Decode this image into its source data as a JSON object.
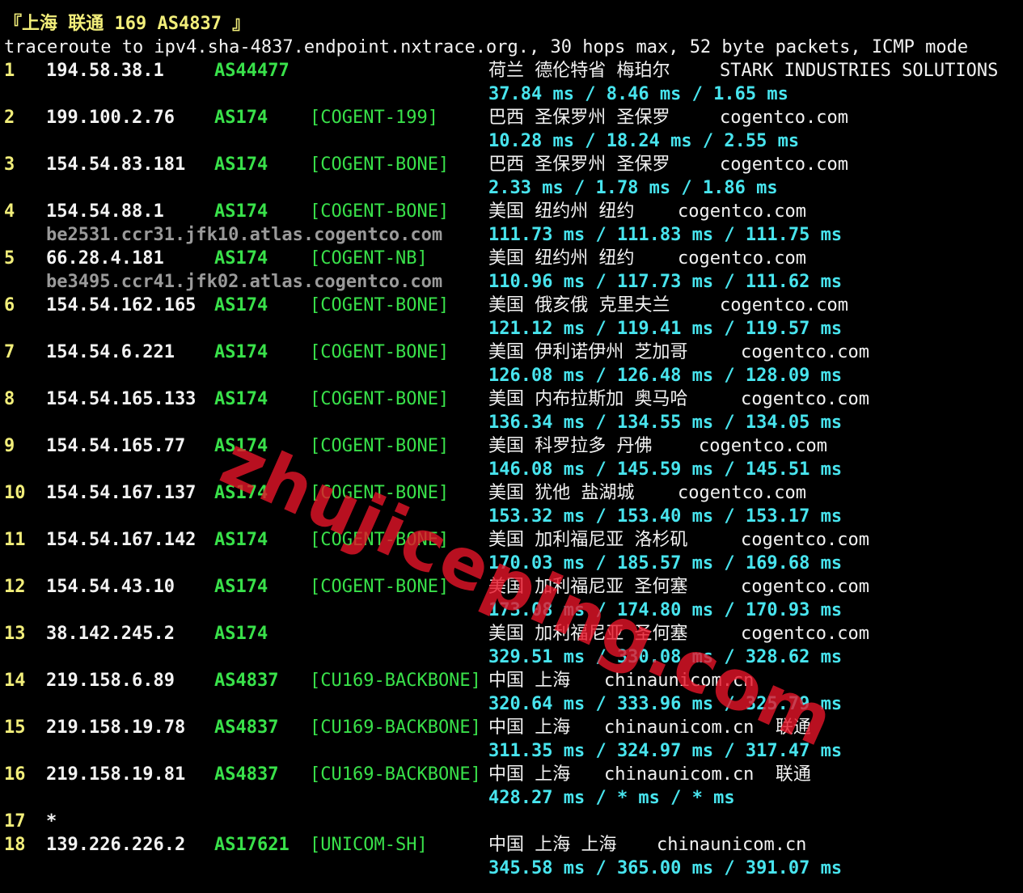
{
  "header": {
    "title": "『上海 联通 169 AS4837 』",
    "command": "traceroute to ipv4.sha-4837.endpoint.nxtrace.org., 30 hops max, 52 byte packets, ICMP mode"
  },
  "hops": [
    {
      "hop": "1",
      "ip": "194.58.38.1",
      "asn": "AS44477",
      "tag": "",
      "geo": "荷兰 德伦特省 梅珀尔",
      "org": "STARK INDUSTRIES SOLUTIONS",
      "rdns": "",
      "rtt": "37.84 ms / 8.46 ms / 1.65 ms"
    },
    {
      "hop": "2",
      "ip": "199.100.2.76",
      "asn": "AS174",
      "tag": "[COGENT-199]",
      "geo": "巴西 圣保罗州 圣保罗",
      "org": "cogentco.com",
      "rdns": "",
      "rtt": "10.28 ms / 18.24 ms / 2.55 ms"
    },
    {
      "hop": "3",
      "ip": "154.54.83.181",
      "asn": "AS174",
      "tag": "[COGENT-BONE]",
      "geo": "巴西 圣保罗州 圣保罗",
      "org": "cogentco.com",
      "rdns": "",
      "rtt": "2.33 ms / 1.78 ms / 1.86 ms"
    },
    {
      "hop": "4",
      "ip": "154.54.88.1",
      "asn": "AS174",
      "tag": "[COGENT-BONE]",
      "geo": "美国 纽约州 纽约",
      "org": "cogentco.com",
      "rdns": "be2531.ccr31.jfk10.atlas.cogentco.com",
      "rtt": "111.73 ms / 111.83 ms / 111.75 ms"
    },
    {
      "hop": "5",
      "ip": "66.28.4.181",
      "asn": "AS174",
      "tag": "[COGENT-NB]",
      "geo": "美国 纽约州 纽约",
      "org": "cogentco.com",
      "rdns": "be3495.ccr41.jfk02.atlas.cogentco.com",
      "rtt": "110.96 ms / 117.73 ms / 111.62 ms"
    },
    {
      "hop": "6",
      "ip": "154.54.162.165",
      "asn": "AS174",
      "tag": "[COGENT-BONE]",
      "geo": "美国 俄亥俄 克里夫兰",
      "org": "cogentco.com",
      "rdns": "",
      "rtt": "121.12 ms / 119.41 ms / 119.57 ms"
    },
    {
      "hop": "7",
      "ip": "154.54.6.221",
      "asn": "AS174",
      "tag": "[COGENT-BONE]",
      "geo": "美国 伊利诺伊州 芝加哥",
      "org": "cogentco.com",
      "rdns": "",
      "rtt": "126.08 ms / 126.48 ms / 128.09 ms"
    },
    {
      "hop": "8",
      "ip": "154.54.165.133",
      "asn": "AS174",
      "tag": "[COGENT-BONE]",
      "geo": "美国 内布拉斯加 奥马哈",
      "org": "cogentco.com",
      "rdns": "",
      "rtt": "136.34 ms / 134.55 ms / 134.05 ms"
    },
    {
      "hop": "9",
      "ip": "154.54.165.77",
      "asn": "AS174",
      "tag": "[COGENT-BONE]",
      "geo": "美国 科罗拉多 丹佛",
      "org": "cogentco.com",
      "rdns": "",
      "rtt": "146.08 ms / 145.59 ms / 145.51 ms"
    },
    {
      "hop": "10",
      "ip": "154.54.167.137",
      "asn": "AS174",
      "tag": "[COGENT-BONE]",
      "geo": "美国 犹他 盐湖城",
      "org": "cogentco.com",
      "rdns": "",
      "rtt": "153.32 ms / 153.40 ms / 153.17 ms"
    },
    {
      "hop": "11",
      "ip": "154.54.167.142",
      "asn": "AS174",
      "tag": "[COGENT-BONE]",
      "geo": "美国 加利福尼亚 洛杉矶",
      "org": "cogentco.com",
      "rdns": "",
      "rtt": "170.03 ms / 185.57 ms / 169.68 ms"
    },
    {
      "hop": "12",
      "ip": "154.54.43.10",
      "asn": "AS174",
      "tag": "[COGENT-BONE]",
      "geo": "美国 加利福尼亚 圣何塞",
      "org": "cogentco.com",
      "rdns": "",
      "rtt": "173.08 ms / 174.80 ms / 170.93 ms"
    },
    {
      "hop": "13",
      "ip": "38.142.245.2",
      "asn": "AS174",
      "tag": "",
      "geo": "美国 加利福尼亚 圣何塞",
      "org": "cogentco.com",
      "rdns": "",
      "rtt": "329.51 ms / 330.08 ms / 328.62 ms"
    },
    {
      "hop": "14",
      "ip": "219.158.6.89",
      "asn": "AS4837",
      "tag": "[CU169-BACKBONE]",
      "geo": "中国 上海",
      "org": "chinaunicom.cn",
      "rdns": "",
      "rtt": "320.64 ms / 333.96 ms / 325.79 ms"
    },
    {
      "hop": "15",
      "ip": "219.158.19.78",
      "asn": "AS4837",
      "tag": "[CU169-BACKBONE]",
      "geo": "中国 上海",
      "org": "chinaunicom.cn  联通",
      "rdns": "",
      "rtt": "311.35 ms / 324.97 ms / 317.47 ms"
    },
    {
      "hop": "16",
      "ip": "219.158.19.81",
      "asn": "AS4837",
      "tag": "[CU169-BACKBONE]",
      "geo": "中国 上海",
      "org": "chinaunicom.cn  联通",
      "rdns": "",
      "rtt": "428.27 ms / * ms / * ms"
    },
    {
      "hop": "17",
      "star": "*"
    },
    {
      "hop": "18",
      "ip": "139.226.226.2",
      "asn": "AS17621",
      "tag": "[UNICOM-SH]",
      "geo": "中国 上海 上海",
      "org": "chinaunicom.cn",
      "rdns": "",
      "rtt": "345.58 ms / 365.00 ms / 391.07 ms"
    }
  ],
  "watermark": "zhujiceping.com",
  "colors": {
    "background": "#000000",
    "hop": "#f2ee7a",
    "ip": "#f2f2f2",
    "asn": "#39e14a",
    "rtt": "#48e4ee",
    "rdns": "#9a9a9a"
  }
}
